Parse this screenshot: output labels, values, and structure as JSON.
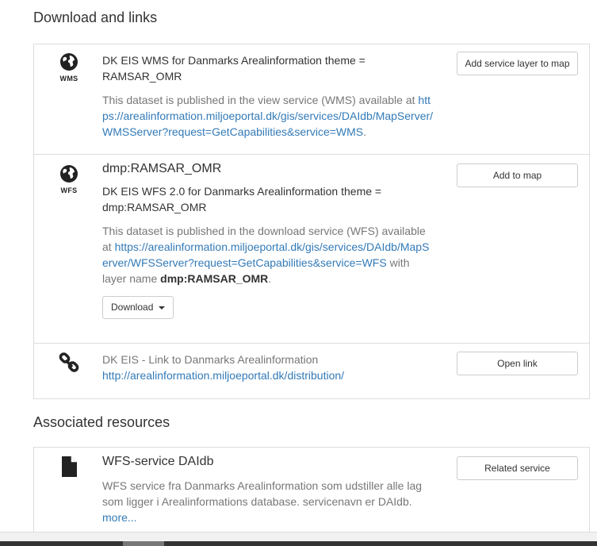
{
  "download_section": {
    "title": "Download and links",
    "items": [
      {
        "icon": "globe-icon",
        "icon_label": "WMS",
        "title": "DK EIS WMS for Danmarks Arealinformation theme = RAMSAR_OMR",
        "description_prefix": "This dataset is published in the view service (WMS) available at",
        "link": "https://arealinformation.miljoeportal.dk/gis/services/DAIdb/MapServer/WMSServer?request=GetCapabilities&service=WMS",
        "description_suffix": ".",
        "button": "Add service layer to map"
      },
      {
        "icon": "globe-icon",
        "icon_label": "WFS",
        "name": "dmp:RAMSAR_OMR",
        "title": "DK EIS WFS 2.0 for Danmarks Arealinformation theme = dmp:RAMSAR_OMR",
        "description_prefix": "This dataset is published in the download service (WFS) available at",
        "link": "https://arealinformation.miljoeportal.dk/gis/services/DAIdb/MapServer/WFSServer?request=GetCapabilities&service=WFS",
        "description_middle": "with layer name",
        "layer_name": "dmp:RAMSAR_OMR",
        "description_suffix": ".",
        "button": "Add to map",
        "download_label": "Download"
      },
      {
        "icon": "link-icon",
        "title": "DK EIS - Link to Danmarks Arealinformation",
        "link": "http://arealinformation.miljoeportal.dk/distribution/",
        "button": "Open link"
      }
    ]
  },
  "associated_section": {
    "title": "Associated resources",
    "items": [
      {
        "icon": "file-icon",
        "name": "WFS-service DAIdb",
        "description": "WFS service fra Danmarks Arealinformation som udstiller alle lag som ligger i Arealinformations database. servicenavn er DAIdb.",
        "more": "more...",
        "button": "Related service"
      }
    ]
  }
}
